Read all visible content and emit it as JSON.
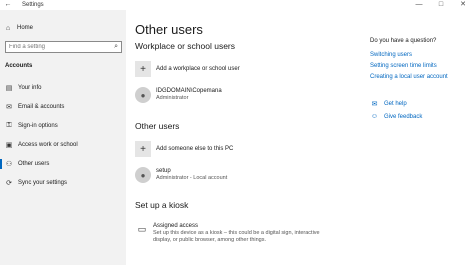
{
  "window": {
    "title": "Settings",
    "back_icon": "←",
    "minimize": "—",
    "maximize": "□",
    "close": "✕"
  },
  "sidebar": {
    "home_label": "Home",
    "search_placeholder": "Find a setting",
    "section": "Accounts",
    "items": [
      {
        "label": "Your info",
        "icon": "person-card-icon",
        "glyph": "▤"
      },
      {
        "label": "Email & accounts",
        "icon": "mail-icon",
        "glyph": "✉"
      },
      {
        "label": "Sign-in options",
        "icon": "key-icon",
        "glyph": "⚿"
      },
      {
        "label": "Access work or school",
        "icon": "briefcase-icon",
        "glyph": "▣"
      },
      {
        "label": "Other users",
        "icon": "person-add-icon",
        "glyph": "⚇"
      },
      {
        "label": "Sync your settings",
        "icon": "sync-icon",
        "glyph": "⟳"
      }
    ],
    "active_index": 4
  },
  "main": {
    "title": "Other users",
    "work_heading": "Workplace or school users",
    "add_work_label": "Add a workplace or school user",
    "work_user_name": "IDGDOMAIN\\Copemana",
    "work_user_role": "Administrator",
    "other_heading": "Other users",
    "add_other_label": "Add someone else to this PC",
    "other_user_name": "setup",
    "other_user_role": "Administrator - Local account",
    "kiosk_heading": "Set up a kiosk",
    "kiosk_title": "Assigned access",
    "kiosk_desc": "Set up this device as a kiosk – this could be a digital sign, interactive display, or public browser, among other things."
  },
  "aside": {
    "question": "Do you have a question?",
    "links": [
      "Switching users",
      "Setting screen time limits",
      "Creating a local user account"
    ],
    "get_help": "Get help",
    "give_feedback": "Give feedback"
  },
  "colors": {
    "accent": "#0067c0",
    "sidebar_bg": "#f2f2f2"
  }
}
